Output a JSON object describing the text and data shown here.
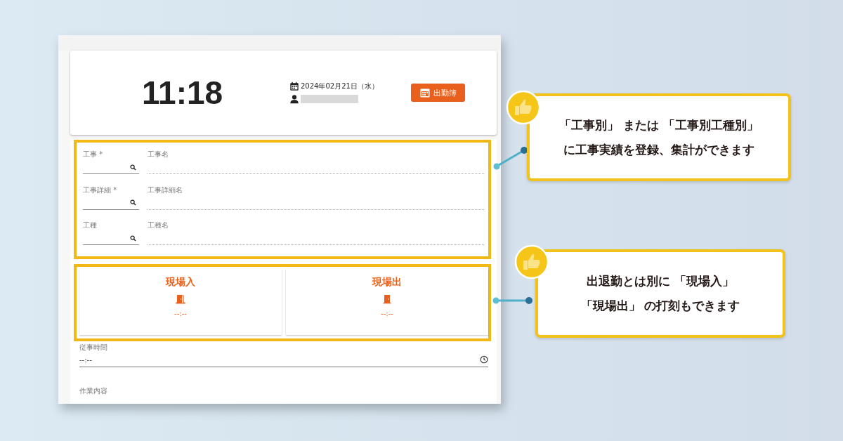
{
  "clock": {
    "time": "11:18",
    "date": "2024年02月21日（水）",
    "attendance_button": "出勤簿"
  },
  "fields": [
    {
      "label": "工事 *",
      "name_label": "工事名"
    },
    {
      "label": "工事詳細 *",
      "name_label": "工事詳細名"
    },
    {
      "label": "工種",
      "name_label": "工種名"
    }
  ],
  "site_cards": [
    {
      "kind": "enter",
      "title": "現場入",
      "time": "--:--"
    },
    {
      "kind": "exit",
      "title": "現場出",
      "time": "--:--"
    }
  ],
  "work_hours": {
    "label": "従事時間",
    "value": "--:--"
  },
  "work_content": {
    "label": "作業内容"
  },
  "callouts": [
    {
      "lines": [
        "「工事別」 または 「工事別工種別」",
        "に工事実績を登録、集計ができます"
      ]
    },
    {
      "lines": [
        "出退勤とは別に 「現場入」",
        "「現場出」 の打刻もできます"
      ]
    }
  ]
}
